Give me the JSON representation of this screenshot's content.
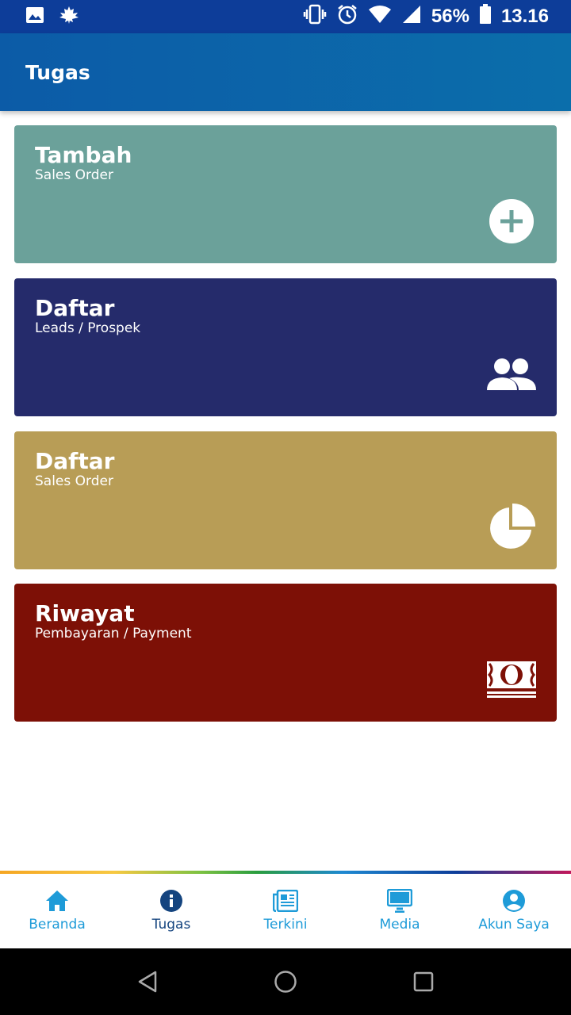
{
  "status_bar": {
    "battery": "56%",
    "time": "13.16",
    "icons": [
      "image-icon",
      "maple-leaf-icon",
      "vibrate-icon",
      "alarm-icon",
      "wifi-icon",
      "signal-icon",
      "battery-icon"
    ]
  },
  "app_bar": {
    "title": "Tugas"
  },
  "cards": [
    {
      "title": "Tambah",
      "subtitle": "Sales Order",
      "color": "#6ba19a",
      "icon": "plus-circle-icon"
    },
    {
      "title": "Daftar",
      "subtitle": "Leads / Prospek",
      "color": "#252b6b",
      "icon": "people-icon"
    },
    {
      "title": "Daftar",
      "subtitle": "Sales Order",
      "color": "#b89d56",
      "icon": "pie-chart-icon"
    },
    {
      "title": "Riwayat",
      "subtitle": "Pembayaran / Payment",
      "color": "#7d1006",
      "icon": "money-icon"
    }
  ],
  "bottom_nav": [
    {
      "label": "Beranda",
      "icon": "home-icon"
    },
    {
      "label": "Tugas",
      "icon": "info-icon",
      "active": true
    },
    {
      "label": "Terkini",
      "icon": "newspaper-icon"
    },
    {
      "label": "Media",
      "icon": "monitor-icon"
    },
    {
      "label": "Akun Saya",
      "icon": "account-icon"
    }
  ],
  "colors": {
    "status_bar": "#0d3d99",
    "app_bar": "#0c64a9",
    "nav_inactive": "#1e9bd8",
    "nav_active": "#14447f"
  }
}
